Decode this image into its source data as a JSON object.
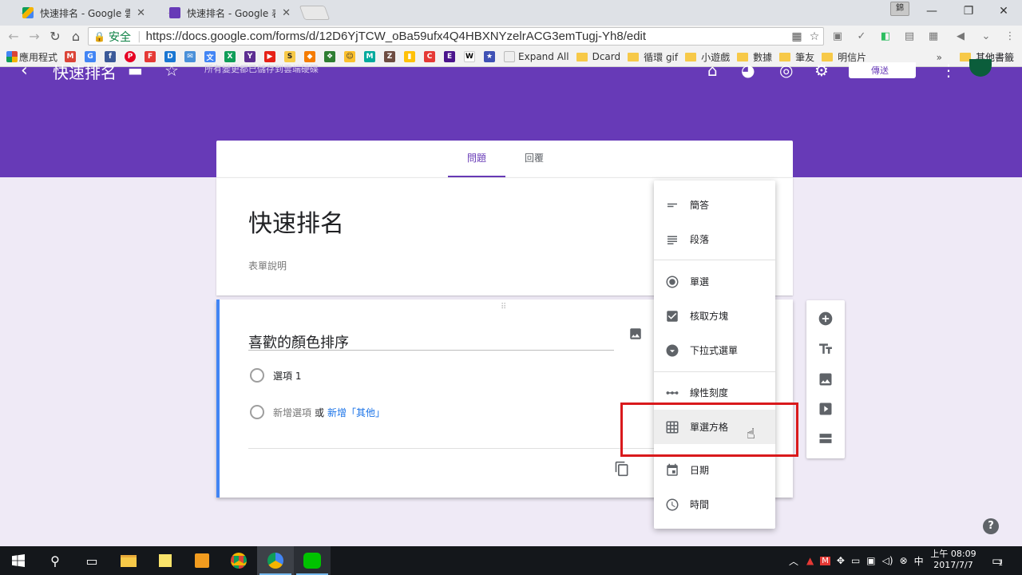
{
  "browser": {
    "tabs": [
      {
        "title": "快速排名 - Google 雲端",
        "close": "✕"
      },
      {
        "title": "快速排名 - Google 表單",
        "close": "✕"
      }
    ],
    "profile_label": "錦",
    "window_controls": {
      "minimize": "—",
      "restore": "❐",
      "close": "✕"
    },
    "address": {
      "secure_label": "安全",
      "url": "https://docs.google.com/forms/d/12D6YjTCW_oBa59ufx4Q4HBXNYzelrACG3emTugj-Yh8/edit"
    },
    "bookmarks": [
      {
        "label": "應用程式",
        "color": "#4285f4",
        "icon": "apps-grid-icon"
      },
      {
        "label": "",
        "color": "#db4437",
        "glyph": "M"
      },
      {
        "label": "",
        "color": "#4285f4",
        "glyph": "G"
      },
      {
        "label": "",
        "color": "#3b5998",
        "glyph": "f"
      },
      {
        "label": "",
        "color": "#e60023",
        "glyph": "P"
      },
      {
        "label": "",
        "color": "#e53935",
        "glyph": "F"
      },
      {
        "label": "",
        "color": "#1976d2",
        "glyph": "D"
      },
      {
        "label": "",
        "color": "#4a90d9",
        "glyph": "✉"
      },
      {
        "label": "",
        "color": "#4285f4",
        "glyph": "文"
      },
      {
        "label": "",
        "color": "#0f9d58",
        "glyph": "X"
      },
      {
        "label": "",
        "color": "#5c2d91",
        "glyph": "Y"
      },
      {
        "label": "",
        "color": "#e62117",
        "glyph": "▶"
      },
      {
        "label": "",
        "color": "#222222",
        "glyph": "S"
      },
      {
        "label": "",
        "color": "#f57c00",
        "glyph": "◆"
      },
      {
        "label": "",
        "color": "#2e7d32",
        "glyph": "❖"
      },
      {
        "label": "",
        "color": "#fbc02d",
        "glyph": "☺"
      },
      {
        "label": "",
        "color": "#00a99d",
        "glyph": "M"
      },
      {
        "label": "",
        "color": "#6d4c41",
        "glyph": "Z"
      },
      {
        "label": "",
        "color": "#ffc107",
        "glyph": "▮"
      },
      {
        "label": "",
        "color": "#e53935",
        "glyph": "C"
      },
      {
        "label": "",
        "color": "#4a148c",
        "glyph": "E"
      },
      {
        "label": "",
        "color": "#ffffff",
        "glyph": "W"
      },
      {
        "label": "",
        "color": "#3f51b5",
        "glyph": "★"
      }
    ],
    "bookmark_text": [
      {
        "label": "Expand All",
        "type": "page"
      },
      {
        "label": "Dcard",
        "type": "folder"
      },
      {
        "label": "循環 gif",
        "type": "folder"
      },
      {
        "label": "小遊戲",
        "type": "folder"
      },
      {
        "label": "數據",
        "type": "folder"
      },
      {
        "label": "筆友",
        "type": "folder"
      },
      {
        "label": "明信片",
        "type": "folder"
      }
    ],
    "more_bookmarks": "»",
    "other_bookmarks": "其他書籤"
  },
  "form": {
    "header_title": "快速排名",
    "header_status": "所有變更都已儲存到雲端硬碟",
    "send_label": "傳送",
    "tabs": {
      "questions": "問題",
      "responses": "回覆"
    },
    "title": "快速排名",
    "description": "表單說明",
    "question": {
      "title": "喜歡的顏色排序",
      "option1": "選項 1",
      "add_option": "新增選項",
      "or": "或",
      "add_other": "新增「其他」"
    },
    "menu": {
      "short_answer": "簡答",
      "paragraph": "段落",
      "multiple_choice": "單選",
      "checkboxes": "核取方塊",
      "dropdown": "下拉式選單",
      "linear_scale": "線性刻度",
      "grid": "單選方格",
      "date": "日期",
      "time": "時間"
    },
    "help": "?"
  },
  "taskbar": {
    "time": "上午 08:09",
    "date": "2017/7/7",
    "notification_count": "1",
    "ime": "中"
  },
  "colors": {
    "accent": "#673ab7",
    "highlight": "#d9191c",
    "link": "#1a73e8"
  }
}
